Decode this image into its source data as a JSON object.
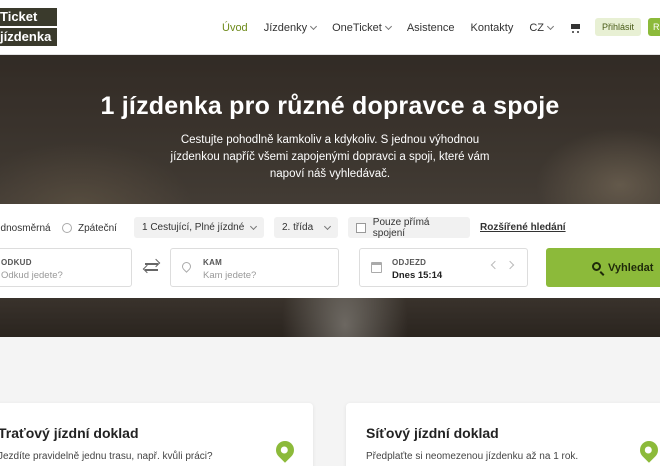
{
  "header": {
    "logo_line1": "Ticket",
    "logo_line2": "jízdenka",
    "nav": [
      {
        "label": "Úvod",
        "active": true,
        "dropdown": false
      },
      {
        "label": "Jízdenky",
        "active": false,
        "dropdown": true
      },
      {
        "label": "OneTicket",
        "active": false,
        "dropdown": true
      },
      {
        "label": "Asistence",
        "active": false,
        "dropdown": false
      },
      {
        "label": "Kontakty",
        "active": false,
        "dropdown": false
      },
      {
        "label": "CZ",
        "active": false,
        "dropdown": true
      }
    ],
    "cart_icon": "cart-icon",
    "login_label": "Přihlásit",
    "register_label": "R"
  },
  "hero": {
    "title": "1 jízdenka pro různé dopravce a spoje",
    "subtitle": "Cestujte pohodlně kamkoliv a kdykoliv. S jednou výhodnou jízdenkou napříč všemi zapojenými dopravci a spoji, které vám napoví náš vyhledávač."
  },
  "search": {
    "trip_oneway": "Jednosměrná",
    "trip_return": "Zpáteční",
    "passengers": "1 Cestující, Plné jízdné",
    "travel_class": "2. třída",
    "direct_only": "Pouze přímá spojení",
    "advanced": "Rozšířené hledání",
    "from_label": "ODKUD",
    "from_placeholder": "Odkud jedete?",
    "to_label": "KAM",
    "to_placeholder": "Kam jedete?",
    "date_label": "ODJEZD",
    "date_value": "Dnes 15:14",
    "search_button": "Vyhledat"
  },
  "cards": [
    {
      "title": "Traťový jízdní doklad",
      "text": "Jezdíte pravidelně jednu trasu, např. kvůli práci?"
    },
    {
      "title": "Síťový jízdní doklad",
      "text": "Předplaťte si neomezenou jízdenku až na 1 rok."
    }
  ],
  "colors": {
    "accent": "#8cba3a",
    "active_nav": "#6e8a1a"
  }
}
